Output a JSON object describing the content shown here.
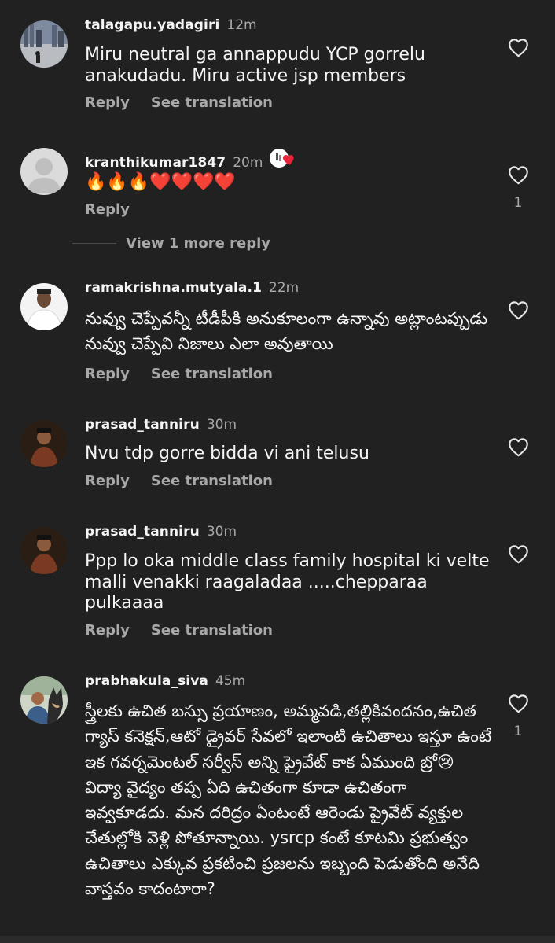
{
  "comments": [
    {
      "username": "talagapu.yadagiri",
      "time": "12m",
      "text": "Miru neutral ga annappudu YCP gorrelu anakudadu. Miru active jsp members",
      "reply": "Reply",
      "see_translation": "See translation",
      "like_count": ""
    },
    {
      "username": "kranthikumar1847",
      "time": "20m",
      "text": "🔥🔥🔥❤️❤️❤️❤️",
      "reply": "Reply",
      "see_translation": "",
      "like_count": "1"
    },
    {
      "username": "ramakrishna.mutyala.1",
      "time": "22m",
      "text": "నువ్వు చెప్పేవన్నీ టీడీపీకి అనుకూలంగా ఉన్నావు అట్లాంటప్పుడు నువ్వు చెప్పేవి నిజాలు ఎలా అవుతాయి",
      "reply": "Reply",
      "see_translation": "See translation",
      "like_count": ""
    },
    {
      "username": "prasad_tanniru",
      "time": "30m",
      "text": "Nvu tdp gorre bidda vi ani telusu",
      "reply": "Reply",
      "see_translation": "See translation",
      "like_count": ""
    },
    {
      "username": "prasad_tanniru",
      "time": "30m",
      "text": "Ppp lo oka middle class family hospital ki velte malli venakki raagaladaa .....chepparaa pulkaaaa",
      "reply": "Reply",
      "see_translation": "See translation",
      "like_count": ""
    },
    {
      "username": "prabhakula_siva",
      "time": "45m",
      "text": "స్త్రీలకు ఉచిత బస్సు ప్రయాణం, అమ్మవడి,తల్లికివందనం,ఉచిత గ్యాస్ కనెక్షన్,ఆటో డ్రైవర్ సేవలో ఇలాంటి ఉచితాలు ఇస్తూ ఉంటే ఇక గవర్నమెంటల్ సర్వీస్ అన్ని ప్రైవేట్ కాక ఏముంది బ్రో😢 విద్యా వైద్యం తప్ప ఏది ఉచితంగా కూడా ఉచితంగా ఇవ్వకూడదు. మన దరిద్రం ఏంటంటే ఆరెండు ప్రైవేట్ వ్యక్తుల చేతుల్లోకి వెళ్లి పోతూన్నాయి. ysrcp కంటే కూటమి ప్రభుత్వం ఉచితాలు ఎక్కువ ప్రకటించి ప్రజలను ఇబ్బంది పెడుతోంది అనేది వాస్తవం కాదంటారా?",
      "reply": "Reply",
      "see_translation": "",
      "like_count": "1"
    }
  ],
  "view_more_reply": "View 1 more reply",
  "colors": {
    "background": "#212121",
    "primary_text": "#f5f5f5",
    "secondary_text": "#a8a8a8"
  },
  "icons": {
    "like": "heart-outline-icon",
    "badge": "heart-sticker-icon",
    "default_avatar": "person-silhouette-icon"
  }
}
